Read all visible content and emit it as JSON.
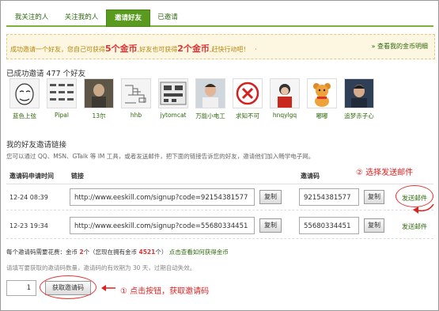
{
  "tabs": [
    {
      "label": "我关注的人"
    },
    {
      "label": "关注我的人"
    },
    {
      "label": "邀请好友"
    },
    {
      "label": "已邀请"
    }
  ],
  "info": {
    "text_1": "成功邀请一个好友，您自己可获得",
    "reward_self": "5个金币",
    "text_2": ",好友也可获得",
    "reward_friend": "2个金币",
    "text_3": ",赶快行动吧！",
    "dot": "·",
    "link": "» 查看我的金币明细"
  },
  "invited": {
    "title": "已成功邀请 477 个好友",
    "friends": [
      {
        "name": "蓝色上弦",
        "icon": "meme-face-avatar"
      },
      {
        "name": "Pipal",
        "icon": "dotted-grid-avatar"
      },
      {
        "name": "13尔",
        "icon": "photo-avatar"
      },
      {
        "name": "hhb",
        "icon": "circuit-avatar"
      },
      {
        "name": "jytomcat",
        "icon": "circuit-board-avatar"
      },
      {
        "name": "万能小电工",
        "icon": "person-photo-avatar"
      },
      {
        "name": "求知不可",
        "icon": "red-x-avatar"
      },
      {
        "name": "hnqylgq",
        "icon": "person-avatar"
      },
      {
        "name": "嘟嘟",
        "icon": "teddy-bear-avatar"
      },
      {
        "name": "追梦赤子心",
        "icon": "person-photo-avatar"
      }
    ]
  },
  "links": {
    "title": "我的好友邀请链接",
    "desc": "您可以通过 QQ、MSN、GTalk 等 IM 工具，或者发送邮件，把下面的链接告诉您的好友，邀请他们加入畅学电子网。",
    "headers": {
      "time": "邀请码申请时间",
      "link": "链接",
      "code": "邀请码"
    },
    "copy_label": "复制",
    "send_label": "发送邮件",
    "rows": [
      {
        "time": "12-24 08:39",
        "url": "http://www.eeskill.com/signup?code=92154381577",
        "code": "92154381577"
      },
      {
        "time": "12-23 19:34",
        "url": "http://www.eeskill.com/signup?code=55680334451",
        "code": "55680334451"
      }
    ]
  },
  "footer": {
    "cost_1": "每个邀请码需要花费：金币",
    "cost_val": "2",
    "cost_2": "个（您现在拥有金币",
    "coins": "4521",
    "cost_3": "个）",
    "cost_link": "点击查看如何获得金币",
    "note": "请填写要获取的邀请码数量，邀请码的有效期为 30 天，过期自动失效。",
    "quantity": "1",
    "get_button": "获取邀请码"
  },
  "annotations": {
    "step1": "①  点击按钮，获取邀请码",
    "step2": "②  选择发送邮件",
    "color": "#e02020"
  },
  "colors": {
    "accent": "#5a9a1e",
    "link": "#2f6a0d",
    "highlight": "#d33333"
  }
}
